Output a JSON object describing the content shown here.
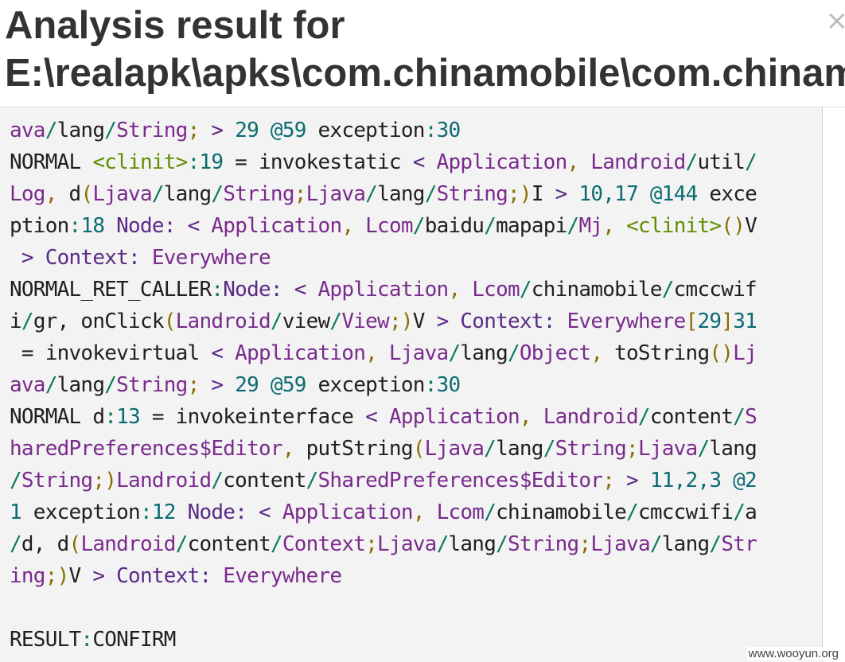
{
  "header": {
    "title_line1": "Analysis result for",
    "title_line2": "E:\\realapk\\apks\\com.chinamobile\\com.chinamobile.cmccwifi",
    "close_glyph": "×"
  },
  "watermark": "www.wooyun.org",
  "colors": {
    "background": "#f3f3f3",
    "keyword": "#5b2a86",
    "type": "#7a2a8c",
    "clinit": "#5f8f00",
    "number": "#0b6b72"
  },
  "code_lines": [
    [
      [
        "t-type",
        "ava"
      ],
      [
        "t-slash",
        "/"
      ],
      [
        "t-plain",
        "lang"
      ],
      [
        "t-slash",
        "/"
      ],
      [
        "t-type",
        "String"
      ],
      [
        "t-punct",
        ";"
      ],
      [
        "t-plain",
        " "
      ],
      [
        "t-key",
        ">"
      ],
      [
        "t-plain",
        " "
      ],
      [
        "t-num",
        "29"
      ],
      [
        "t-plain",
        " "
      ],
      [
        "t-num",
        "@59"
      ],
      [
        "t-plain",
        " exception"
      ],
      [
        "t-slash",
        ":"
      ],
      [
        "t-num",
        "30"
      ]
    ],
    [
      [
        "t-plain",
        "NORMAL "
      ],
      [
        "t-green",
        "<clinit>"
      ],
      [
        "t-slash",
        ":"
      ],
      [
        "t-num",
        "19"
      ],
      [
        "t-plain",
        " = invokestatic "
      ],
      [
        "t-key",
        "<"
      ],
      [
        "t-plain",
        " "
      ],
      [
        "t-type",
        "Application"
      ],
      [
        "t-punct",
        ","
      ],
      [
        "t-plain",
        " "
      ],
      [
        "t-type",
        "Landroid"
      ],
      [
        "t-slash",
        "/"
      ],
      [
        "t-plain",
        "util"
      ],
      [
        "t-slash",
        "/"
      ]
    ],
    [
      [
        "t-type",
        "Log"
      ],
      [
        "t-punct",
        ","
      ],
      [
        "t-plain",
        " d"
      ],
      [
        "t-punct",
        "("
      ],
      [
        "t-type",
        "Ljava"
      ],
      [
        "t-slash",
        "/"
      ],
      [
        "t-plain",
        "lang"
      ],
      [
        "t-slash",
        "/"
      ],
      [
        "t-type",
        "String"
      ],
      [
        "t-punct",
        ";"
      ],
      [
        "t-type",
        "Ljava"
      ],
      [
        "t-slash",
        "/"
      ],
      [
        "t-plain",
        "lang"
      ],
      [
        "t-slash",
        "/"
      ],
      [
        "t-type",
        "String"
      ],
      [
        "t-punct",
        ";)"
      ],
      [
        "t-plain",
        "I "
      ],
      [
        "t-key",
        ">"
      ],
      [
        "t-plain",
        " "
      ],
      [
        "t-num",
        "10,17"
      ],
      [
        "t-plain",
        " "
      ],
      [
        "t-num",
        "@144"
      ],
      [
        "t-plain",
        " exce"
      ]
    ],
    [
      [
        "t-plain",
        "ption"
      ],
      [
        "t-slash",
        ":"
      ],
      [
        "t-num",
        "18"
      ],
      [
        "t-plain",
        " "
      ],
      [
        "t-key",
        "Node:"
      ],
      [
        "t-plain",
        " "
      ],
      [
        "t-key",
        "<"
      ],
      [
        "t-plain",
        " "
      ],
      [
        "t-type",
        "Application"
      ],
      [
        "t-punct",
        ","
      ],
      [
        "t-plain",
        " "
      ],
      [
        "t-type",
        "Lcom"
      ],
      [
        "t-slash",
        "/"
      ],
      [
        "t-plain",
        "baidu"
      ],
      [
        "t-slash",
        "/"
      ],
      [
        "t-plain",
        "mapapi"
      ],
      [
        "t-slash",
        "/"
      ],
      [
        "t-type",
        "Mj"
      ],
      [
        "t-punct",
        ","
      ],
      [
        "t-plain",
        " "
      ],
      [
        "t-green",
        "<clinit>"
      ],
      [
        "t-punct",
        "()"
      ],
      [
        "t-plain",
        "V"
      ]
    ],
    [
      [
        "t-plain",
        " "
      ],
      [
        "t-key",
        ">"
      ],
      [
        "t-plain",
        " "
      ],
      [
        "t-key",
        "Context:"
      ],
      [
        "t-plain",
        " "
      ],
      [
        "t-type",
        "Everywhere"
      ]
    ],
    [
      [
        "t-plain",
        "NORMAL_RET_CALLER"
      ],
      [
        "t-slash",
        ":"
      ],
      [
        "t-key",
        "Node:"
      ],
      [
        "t-plain",
        " "
      ],
      [
        "t-key",
        "<"
      ],
      [
        "t-plain",
        " "
      ],
      [
        "t-type",
        "Application"
      ],
      [
        "t-punct",
        ","
      ],
      [
        "t-plain",
        " "
      ],
      [
        "t-type",
        "Lcom"
      ],
      [
        "t-slash",
        "/"
      ],
      [
        "t-plain",
        "chinamobile"
      ],
      [
        "t-slash",
        "/"
      ],
      [
        "t-plain",
        "cmccwif"
      ]
    ],
    [
      [
        "t-plain",
        "i"
      ],
      [
        "t-slash",
        "/"
      ],
      [
        "t-plain",
        "gr, onClick"
      ],
      [
        "t-punct",
        "("
      ],
      [
        "t-type",
        "Landroid"
      ],
      [
        "t-slash",
        "/"
      ],
      [
        "t-plain",
        "view"
      ],
      [
        "t-slash",
        "/"
      ],
      [
        "t-type",
        "View"
      ],
      [
        "t-punct",
        ";)"
      ],
      [
        "t-plain",
        "V "
      ],
      [
        "t-key",
        ">"
      ],
      [
        "t-plain",
        " "
      ],
      [
        "t-key",
        "Context:"
      ],
      [
        "t-plain",
        " "
      ],
      [
        "t-type",
        "Everywhere"
      ],
      [
        "t-punct",
        "["
      ],
      [
        "t-num",
        "29"
      ],
      [
        "t-punct",
        "]"
      ],
      [
        "t-num",
        "31"
      ]
    ],
    [
      [
        "t-plain",
        " = invokevirtual "
      ],
      [
        "t-key",
        "<"
      ],
      [
        "t-plain",
        " "
      ],
      [
        "t-type",
        "Application"
      ],
      [
        "t-punct",
        ","
      ],
      [
        "t-plain",
        " "
      ],
      [
        "t-type",
        "Ljava"
      ],
      [
        "t-slash",
        "/"
      ],
      [
        "t-plain",
        "lang"
      ],
      [
        "t-slash",
        "/"
      ],
      [
        "t-type",
        "Object"
      ],
      [
        "t-punct",
        ","
      ],
      [
        "t-plain",
        " toString"
      ],
      [
        "t-punct",
        "()"
      ],
      [
        "t-type",
        "Lj"
      ]
    ],
    [
      [
        "t-type",
        "ava"
      ],
      [
        "t-slash",
        "/"
      ],
      [
        "t-plain",
        "lang"
      ],
      [
        "t-slash",
        "/"
      ],
      [
        "t-type",
        "String"
      ],
      [
        "t-punct",
        ";"
      ],
      [
        "t-plain",
        " "
      ],
      [
        "t-key",
        ">"
      ],
      [
        "t-plain",
        " "
      ],
      [
        "t-num",
        "29"
      ],
      [
        "t-plain",
        " "
      ],
      [
        "t-num",
        "@59"
      ],
      [
        "t-plain",
        " exception"
      ],
      [
        "t-slash",
        ":"
      ],
      [
        "t-num",
        "30"
      ]
    ],
    [
      [
        "t-plain",
        "NORMAL d"
      ],
      [
        "t-slash",
        ":"
      ],
      [
        "t-num",
        "13"
      ],
      [
        "t-plain",
        " = invokeinterface "
      ],
      [
        "t-key",
        "<"
      ],
      [
        "t-plain",
        " "
      ],
      [
        "t-type",
        "Application"
      ],
      [
        "t-punct",
        ","
      ],
      [
        "t-plain",
        " "
      ],
      [
        "t-type",
        "Landroid"
      ],
      [
        "t-slash",
        "/"
      ],
      [
        "t-plain",
        "content"
      ],
      [
        "t-slash",
        "/"
      ],
      [
        "t-type",
        "S"
      ]
    ],
    [
      [
        "t-type",
        "haredPreferences$Editor"
      ],
      [
        "t-punct",
        ","
      ],
      [
        "t-plain",
        " putString"
      ],
      [
        "t-punct",
        "("
      ],
      [
        "t-type",
        "Ljava"
      ],
      [
        "t-slash",
        "/"
      ],
      [
        "t-plain",
        "lang"
      ],
      [
        "t-slash",
        "/"
      ],
      [
        "t-type",
        "String"
      ],
      [
        "t-punct",
        ";"
      ],
      [
        "t-type",
        "Ljava"
      ],
      [
        "t-slash",
        "/"
      ],
      [
        "t-plain",
        "lang"
      ]
    ],
    [
      [
        "t-slash",
        "/"
      ],
      [
        "t-type",
        "String"
      ],
      [
        "t-punct",
        ";)"
      ],
      [
        "t-type",
        "Landroid"
      ],
      [
        "t-slash",
        "/"
      ],
      [
        "t-plain",
        "content"
      ],
      [
        "t-slash",
        "/"
      ],
      [
        "t-type",
        "SharedPreferences$Editor"
      ],
      [
        "t-punct",
        ";"
      ],
      [
        "t-plain",
        " "
      ],
      [
        "t-key",
        ">"
      ],
      [
        "t-plain",
        " "
      ],
      [
        "t-num",
        "11,2,3"
      ],
      [
        "t-plain",
        " "
      ],
      [
        "t-num",
        "@2"
      ]
    ],
    [
      [
        "t-num",
        "1"
      ],
      [
        "t-plain",
        " exception"
      ],
      [
        "t-slash",
        ":"
      ],
      [
        "t-num",
        "12"
      ],
      [
        "t-plain",
        " "
      ],
      [
        "t-key",
        "Node:"
      ],
      [
        "t-plain",
        " "
      ],
      [
        "t-key",
        "<"
      ],
      [
        "t-plain",
        " "
      ],
      [
        "t-type",
        "Application"
      ],
      [
        "t-punct",
        ","
      ],
      [
        "t-plain",
        " "
      ],
      [
        "t-type",
        "Lcom"
      ],
      [
        "t-slash",
        "/"
      ],
      [
        "t-plain",
        "chinamobile"
      ],
      [
        "t-slash",
        "/"
      ],
      [
        "t-plain",
        "cmccwifi"
      ],
      [
        "t-slash",
        "/"
      ],
      [
        "t-plain",
        "a"
      ]
    ],
    [
      [
        "t-slash",
        "/"
      ],
      [
        "t-plain",
        "d, d"
      ],
      [
        "t-punct",
        "("
      ],
      [
        "t-type",
        "Landroid"
      ],
      [
        "t-slash",
        "/"
      ],
      [
        "t-plain",
        "content"
      ],
      [
        "t-slash",
        "/"
      ],
      [
        "t-type",
        "Context"
      ],
      [
        "t-punct",
        ";"
      ],
      [
        "t-type",
        "Ljava"
      ],
      [
        "t-slash",
        "/"
      ],
      [
        "t-plain",
        "lang"
      ],
      [
        "t-slash",
        "/"
      ],
      [
        "t-type",
        "String"
      ],
      [
        "t-punct",
        ";"
      ],
      [
        "t-type",
        "Ljava"
      ],
      [
        "t-slash",
        "/"
      ],
      [
        "t-plain",
        "lang"
      ],
      [
        "t-slash",
        "/"
      ],
      [
        "t-type",
        "Str"
      ]
    ],
    [
      [
        "t-type",
        "ing"
      ],
      [
        "t-punct",
        ";)"
      ],
      [
        "t-plain",
        "V "
      ],
      [
        "t-key",
        ">"
      ],
      [
        "t-plain",
        " "
      ],
      [
        "t-key",
        "Context:"
      ],
      [
        "t-plain",
        " "
      ],
      [
        "t-type",
        "Everywhere"
      ]
    ],
    [
      [
        "t-plain",
        ""
      ]
    ],
    [
      [
        "t-plain",
        "RESULT"
      ],
      [
        "t-slash",
        ":"
      ],
      [
        "t-plain",
        "CONFIRM"
      ]
    ]
  ]
}
